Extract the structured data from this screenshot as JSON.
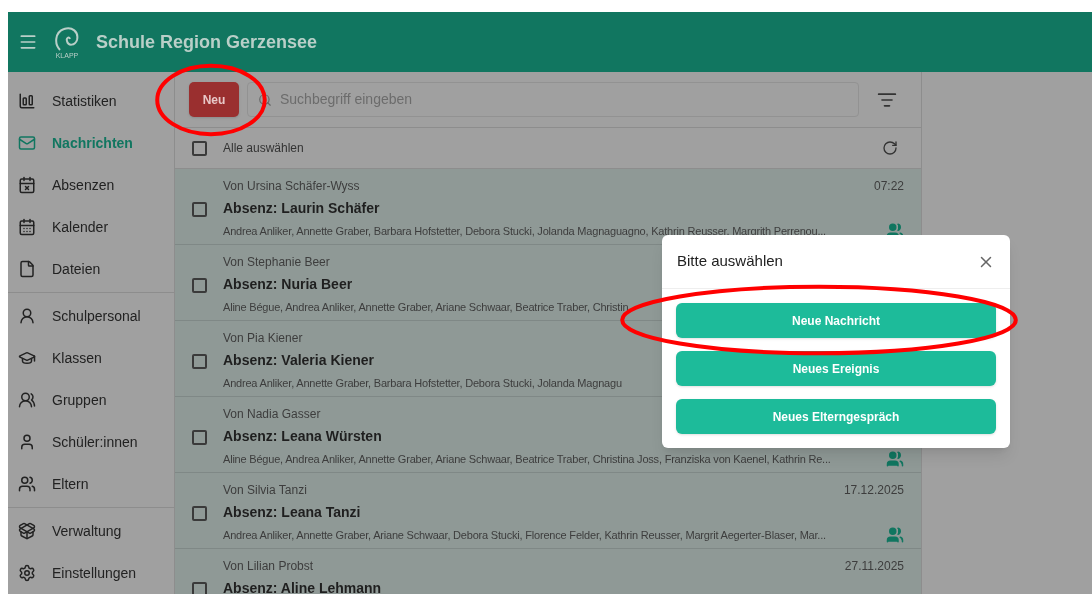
{
  "header": {
    "title": "Schule Region Gerzensee",
    "logo_text": "KLAPP"
  },
  "sidebar": {
    "groups": [
      [
        {
          "label": "Statistiken",
          "selected": false
        },
        {
          "label": "Nachrichten",
          "selected": true
        },
        {
          "label": "Absenzen",
          "selected": false
        },
        {
          "label": "Kalender",
          "selected": false
        },
        {
          "label": "Dateien",
          "selected": false
        }
      ],
      [
        {
          "label": "Schulpersonal",
          "selected": false
        },
        {
          "label": "Klassen",
          "selected": false
        },
        {
          "label": "Gruppen",
          "selected": false
        },
        {
          "label": "Schüler:innen",
          "selected": false
        },
        {
          "label": "Eltern",
          "selected": false
        }
      ],
      [
        {
          "label": "Verwaltung",
          "selected": false
        },
        {
          "label": "Einstellungen",
          "selected": false
        }
      ]
    ]
  },
  "toolbar": {
    "new_button": {
      "label": "Neu",
      "highlighted": true
    },
    "search": {
      "placeholder": "Suchbegriff eingeben"
    }
  },
  "list": {
    "select_all": {
      "label": "Alle auswählen",
      "checked": false
    },
    "rows": [
      {
        "sender": "Von Ursina Schäfer-Wyss",
        "subject": "Absenz: Laurin Schäfer",
        "recipients": "Andrea Anliker, Annette Graber, Barbara Hofstetter, Debora Stucki, Jolanda Magnaguagno, Kathrin Reusser, Margrith Perrenou...",
        "time": "07:22",
        "checked": false
      },
      {
        "sender": "Von Stephanie Beer",
        "subject": "Absenz: Nuria Beer",
        "recipients": "Aline Bégue, Andrea Anliker, Annette Graber, Ariane Schwaar, Beatrice Traber, Christin",
        "checked": false
      },
      {
        "sender": "Von Pia Kiener",
        "subject": "Absenz: Valeria Kiener",
        "recipients": "Andrea Anliker, Annette Graber, Barbara Hofstetter, Debora Stucki, Jolanda Magnagu",
        "checked": false
      },
      {
        "sender": "Von Nadia Gasser",
        "subject": "Absenz: Leana Würsten",
        "recipients": "Aline Bégue, Andrea Anliker, Annette Graber, Ariane Schwaar, Beatrice Traber, Christina Joss, Franziska von Kaenel, Kathrin Re...",
        "checked": false
      },
      {
        "sender": "Von Silvia Tanzi",
        "subject": "Absenz: Leana Tanzi",
        "recipients": "Andrea Anliker, Annette Graber, Ariane Schwaar, Debora Stucki, Florence Felder, Kathrin Reusser, Margrit Aegerter-Blaser, Mar...",
        "time": "17.12.2025",
        "checked": false
      },
      {
        "sender": "Von Lilian Probst",
        "subject": "Absenz: Aline Lehmann",
        "time": "27.11.2025",
        "checked": false
      }
    ]
  },
  "dialog": {
    "title": "Bitte auswählen",
    "options": [
      {
        "label": "Neue Nachricht",
        "highlighted": true
      },
      {
        "label": "Neues Ereignis",
        "highlighted": false
      },
      {
        "label": "Neues Elterngespräch",
        "highlighted": false
      }
    ]
  }
}
